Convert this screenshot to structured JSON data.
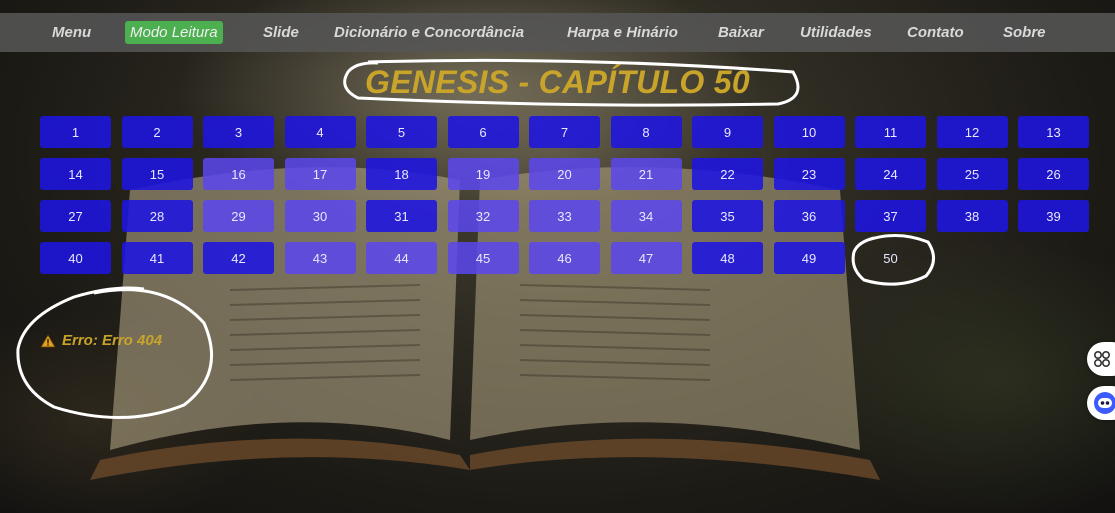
{
  "nav": {
    "items": [
      {
        "label": "Menu",
        "active": false
      },
      {
        "label": "Modo Leitura",
        "active": true
      },
      {
        "label": "Slide",
        "active": false
      },
      {
        "label": "Dicionário e Concordância",
        "active": false
      },
      {
        "label": "Harpa e Hinário",
        "active": false
      },
      {
        "label": "Baixar",
        "active": false
      },
      {
        "label": "Utilidades",
        "active": false
      },
      {
        "label": "Contato",
        "active": false
      },
      {
        "label": "Sobre",
        "active": false
      }
    ]
  },
  "page": {
    "title": "GENESIS - CAPÍTULO 50"
  },
  "chapters": {
    "current": "50",
    "list": [
      "1",
      "2",
      "3",
      "4",
      "5",
      "6",
      "7",
      "8",
      "9",
      "10",
      "11",
      "12",
      "13",
      "14",
      "15",
      "16",
      "17",
      "18",
      "19",
      "20",
      "21",
      "22",
      "23",
      "24",
      "25",
      "26",
      "27",
      "28",
      "29",
      "30",
      "31",
      "32",
      "33",
      "34",
      "35",
      "36",
      "37",
      "38",
      "39",
      "40",
      "41",
      "42",
      "43",
      "44",
      "45",
      "46",
      "47",
      "48",
      "49",
      "50"
    ]
  },
  "error": {
    "message": "Erro: Erro 404",
    "icon": "warning-icon"
  },
  "side_widgets": {
    "top_icon": "grid-icon",
    "bottom_icon": "assistant-icon"
  },
  "colors": {
    "accent_gold": "#c8a42a",
    "chapter_button": "#1e14e1",
    "nav_active": "#4caf50"
  }
}
